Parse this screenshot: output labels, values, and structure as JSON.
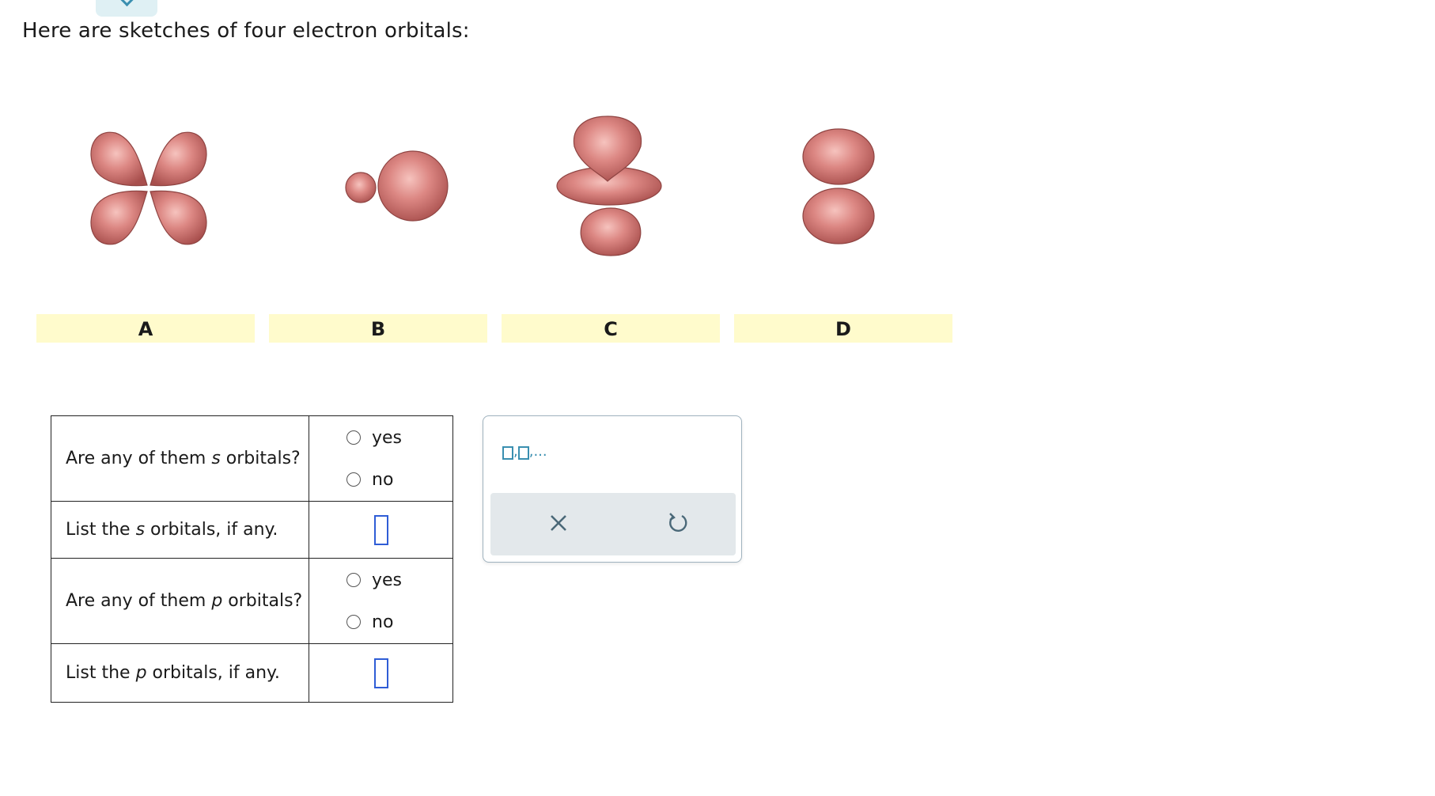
{
  "prompt": "Here are sketches of four electron orbitals:",
  "orbital_labels": [
    "A",
    "B",
    "C",
    "D"
  ],
  "questions": {
    "q1": {
      "text_before": "Are any of them ",
      "italic": "s",
      "text_after": " orbitals?",
      "options": [
        "yes",
        "no"
      ]
    },
    "q2": {
      "text_before": "List the ",
      "italic": "s",
      "text_after": " orbitals, if any."
    },
    "q3": {
      "text_before": "Are any of them ",
      "italic": "p",
      "text_after": " orbitals?",
      "options": [
        "yes",
        "no"
      ]
    },
    "q4": {
      "text_before": "List the ",
      "italic": "p",
      "text_after": " orbitals, if any."
    }
  },
  "toolbox": {
    "list_suffix": ",...",
    "list_sep": ","
  },
  "colors": {
    "lobe": "#c86a66",
    "label_bg": "#fffbcc",
    "accent": "#3a8fb0",
    "input_border": "#2f5dd6"
  }
}
